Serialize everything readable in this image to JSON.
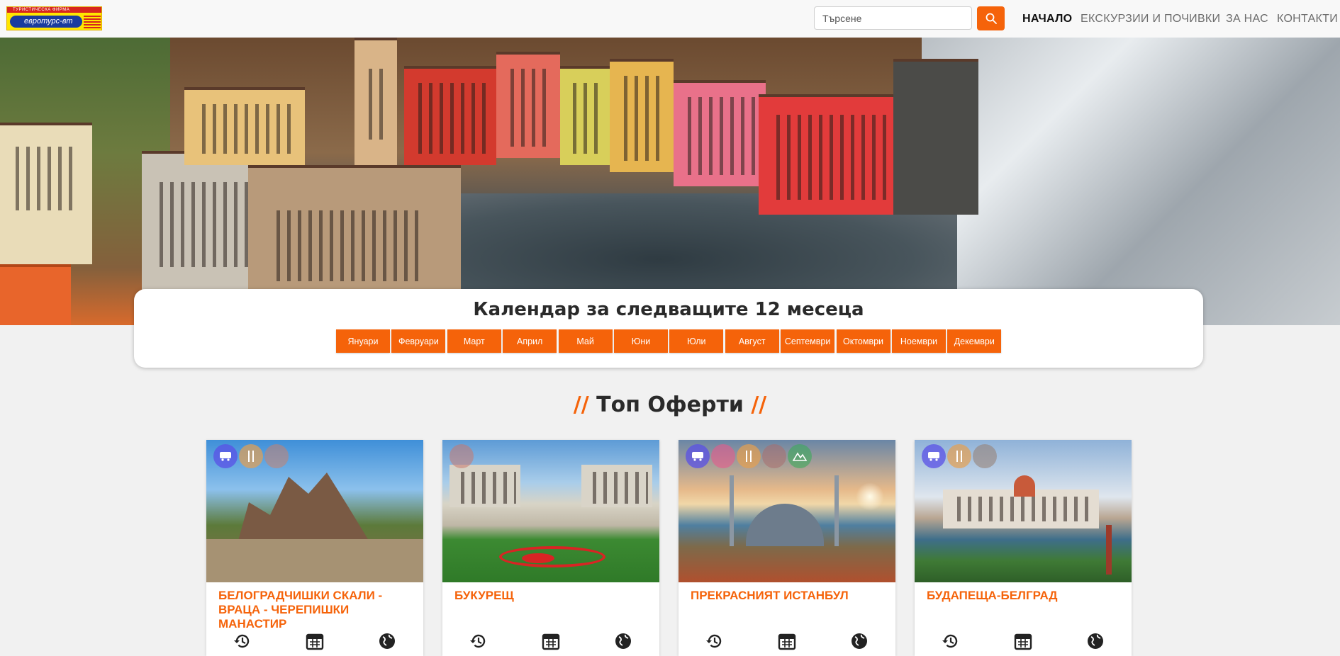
{
  "header": {
    "logo": {
      "top_text": "ТУРИСТИЧЕСКА ФИРМА",
      "brand_text": "евротурс-вт"
    },
    "search": {
      "placeholder": "Търсене"
    },
    "nav": [
      {
        "label": "НАЧАЛО",
        "active": true
      },
      {
        "label": "ЕКСКУРЗИИ И ПОЧИВКИ",
        "active": false
      },
      {
        "label": "ЗА НАС",
        "active": false
      },
      {
        "label": "КОНТАКТИ",
        "active": false
      }
    ]
  },
  "calendar": {
    "title": "Календар за следващите 12 месеца",
    "months": [
      "Януари",
      "Февруари",
      "Март",
      "Април",
      "Май",
      "Юни",
      "Юли",
      "Август",
      "Септември",
      "Октомври",
      "Ноември",
      "Декември"
    ]
  },
  "offers": {
    "title_prefix": "//",
    "title": "Топ Оферти",
    "title_suffix": "//",
    "cards": [
      {
        "title": "БЕЛОГРАДЧИШКИ СКАЛИ - ВРАЦА - ЧЕРЕПИШКИ МАНАСТИР",
        "badges": [
          "bus-icon",
          "food-icon",
          "monument-icon"
        ]
      },
      {
        "title": "БУКУРЕЩ",
        "badges": [
          "hotel-icon"
        ]
      },
      {
        "title": "ПРЕКРАСНИЯТ ИСТАНБУЛ",
        "badges": [
          "bus-icon",
          "hotel-icon",
          "food-icon",
          "camera-icon",
          "mountain-icon"
        ]
      },
      {
        "title": "БУДАПЕЩА-БЕЛГРАД",
        "badges": [
          "bus-icon",
          "food-icon",
          "sightseeing-icon"
        ]
      }
    ],
    "feature_icons": [
      "history-icon",
      "calendar-icon",
      "globe-icon"
    ]
  },
  "colors": {
    "accent": "#f5630a",
    "background": "#f1f1f1"
  }
}
